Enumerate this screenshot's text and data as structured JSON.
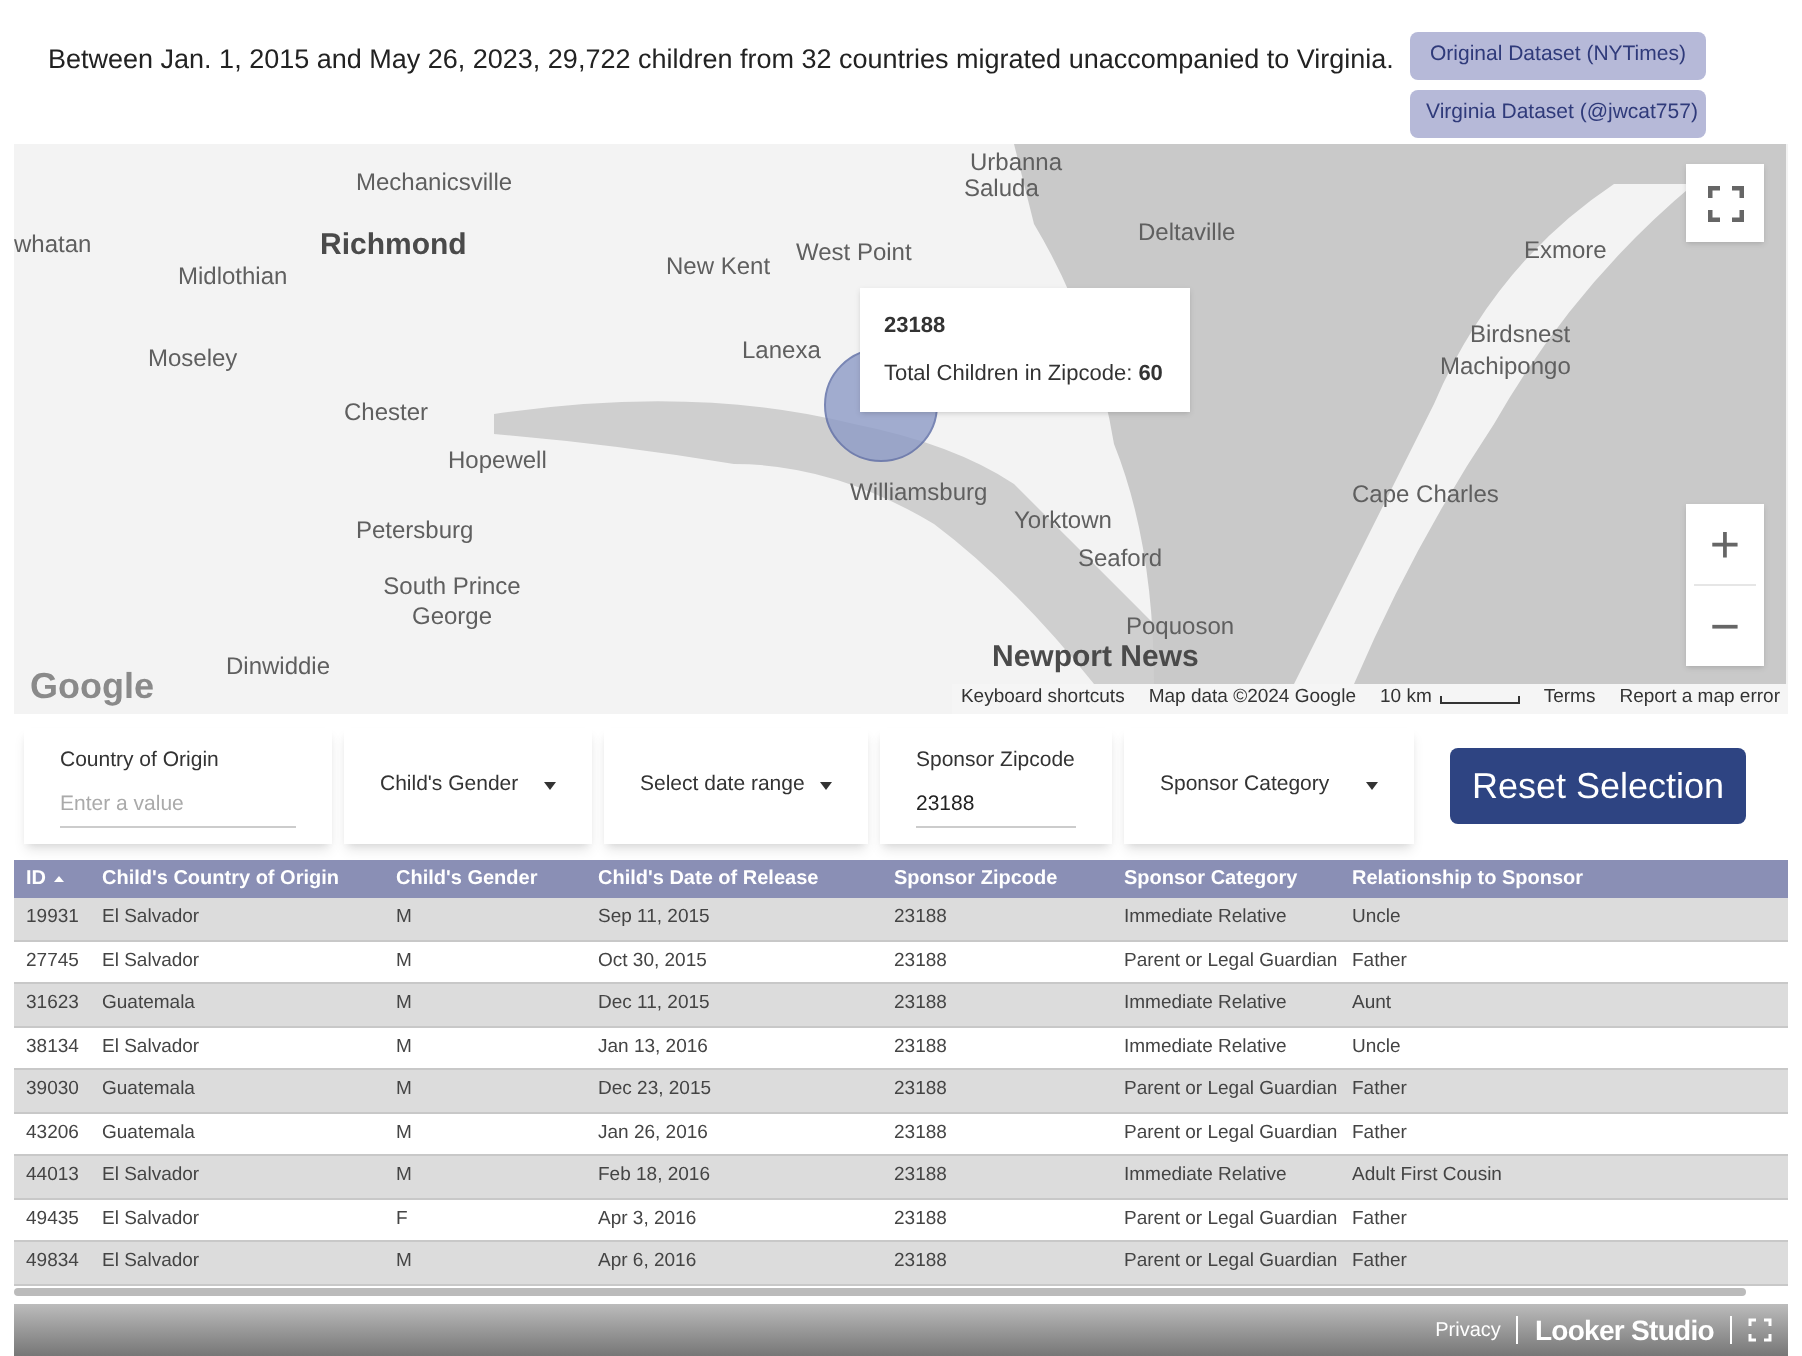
{
  "headline": "Between Jan. 1, 2015 and May 26, 2023, 29,722 children from 32 countries migrated unaccompanied to Virginia.",
  "links": [
    "Original Dataset (NYTimes)",
    "Virginia Dataset (@jwcat757)"
  ],
  "map": {
    "labels": [
      {
        "text": "Mechanicsville",
        "kind": "town"
      },
      {
        "text": "whatan",
        "kind": "town"
      },
      {
        "text": "Richmond",
        "kind": "city"
      },
      {
        "text": "Midlothian",
        "kind": "town"
      },
      {
        "text": "Moseley",
        "kind": "town"
      },
      {
        "text": "Chester",
        "kind": "town"
      },
      {
        "text": "Hopewell",
        "kind": "town"
      },
      {
        "text": "Petersburg",
        "kind": "town"
      },
      {
        "text": "South Prince George",
        "kind": "town"
      },
      {
        "text": "Dinwiddie",
        "kind": "town"
      },
      {
        "text": "New Kent",
        "kind": "town"
      },
      {
        "text": "West Point",
        "kind": "town"
      },
      {
        "text": "Lanexa",
        "kind": "town"
      },
      {
        "text": "Urbanna",
        "kind": "town"
      },
      {
        "text": "Saluda",
        "kind": "town"
      },
      {
        "text": "Deltaville",
        "kind": "town"
      },
      {
        "text": "Williamsburg",
        "kind": "town"
      },
      {
        "text": "Yorktown",
        "kind": "town"
      },
      {
        "text": "Seaford",
        "kind": "town"
      },
      {
        "text": "Poquoson",
        "kind": "town"
      },
      {
        "text": "Newport News",
        "kind": "city"
      },
      {
        "text": "Exmore",
        "kind": "town"
      },
      {
        "text": "Birdsnest",
        "kind": "town"
      },
      {
        "text": "Machipongo",
        "kind": "town"
      },
      {
        "text": "Cape Charles",
        "kind": "town"
      }
    ],
    "tooltip": {
      "zipcode": "23188",
      "line": "Total Children in Zipcode: **60**"
    },
    "logo": "Google",
    "zoom_in": "+",
    "zoom_out": "−",
    "attribution": [
      "Keyboard shortcuts",
      "Map data ©2024 Google",
      "10 km",
      "Terms",
      "Report a map error"
    ]
  },
  "filters": [
    {
      "kind": "text",
      "label": "Country of Origin",
      "placeholder": "Enter a value"
    },
    {
      "kind": "dropdown",
      "label": "Child's Gender"
    },
    {
      "kind": "dropdown",
      "label": "Select date range"
    },
    {
      "kind": "text",
      "label": "Sponsor Zipcode",
      "value": "23188"
    },
    {
      "kind": "dropdown",
      "label": "Sponsor Category"
    }
  ],
  "reset_button": "Reset Selection",
  "table": {
    "columns": [
      {
        "label": "ID",
        "sorted": true
      },
      {
        "label": "Child's Country of Origin",
        "sorted": false
      },
      {
        "label": "Child's Gender",
        "sorted": false
      },
      {
        "label": "Child's Date of Release",
        "sorted": false
      },
      {
        "label": "Sponsor Zipcode",
        "sorted": false
      },
      {
        "label": "Sponsor Category",
        "sorted": false
      },
      {
        "label": "Relationship to Sponsor",
        "sorted": false
      }
    ],
    "rows": [
      [
        "19931",
        "El Salvador",
        "M",
        "Sep 11, 2015",
        "23188",
        "Immediate Relative",
        "Uncle"
      ],
      [
        "27745",
        "El Salvador",
        "M",
        "Oct 30, 2015",
        "23188",
        "Parent or Legal Guardian",
        "Father"
      ],
      [
        "31623",
        "Guatemala",
        "M",
        "Dec 11, 2015",
        "23188",
        "Immediate Relative",
        "Aunt"
      ],
      [
        "38134",
        "El Salvador",
        "M",
        "Jan 13, 2016",
        "23188",
        "Immediate Relative",
        "Uncle"
      ],
      [
        "39030",
        "Guatemala",
        "M",
        "Dec 23, 2015",
        "23188",
        "Parent or Legal Guardian",
        "Father"
      ],
      [
        "43206",
        "Guatemala",
        "M",
        "Jan 26, 2016",
        "23188",
        "Parent or Legal Guardian",
        "Father"
      ],
      [
        "44013",
        "El Salvador",
        "M",
        "Feb 18, 2016",
        "23188",
        "Immediate Relative",
        "Adult First Cousin"
      ],
      [
        "49435",
        "El Salvador",
        "F",
        "Apr 3, 2016",
        "23188",
        "Parent or Legal Guardian",
        "Father"
      ],
      [
        "49834",
        "El Salvador",
        "M",
        "Apr 6, 2016",
        "23188",
        "Parent or Legal Guardian",
        "Father"
      ]
    ]
  },
  "footer": {
    "privacy": "Privacy",
    "brand": "Looker Studio"
  }
}
